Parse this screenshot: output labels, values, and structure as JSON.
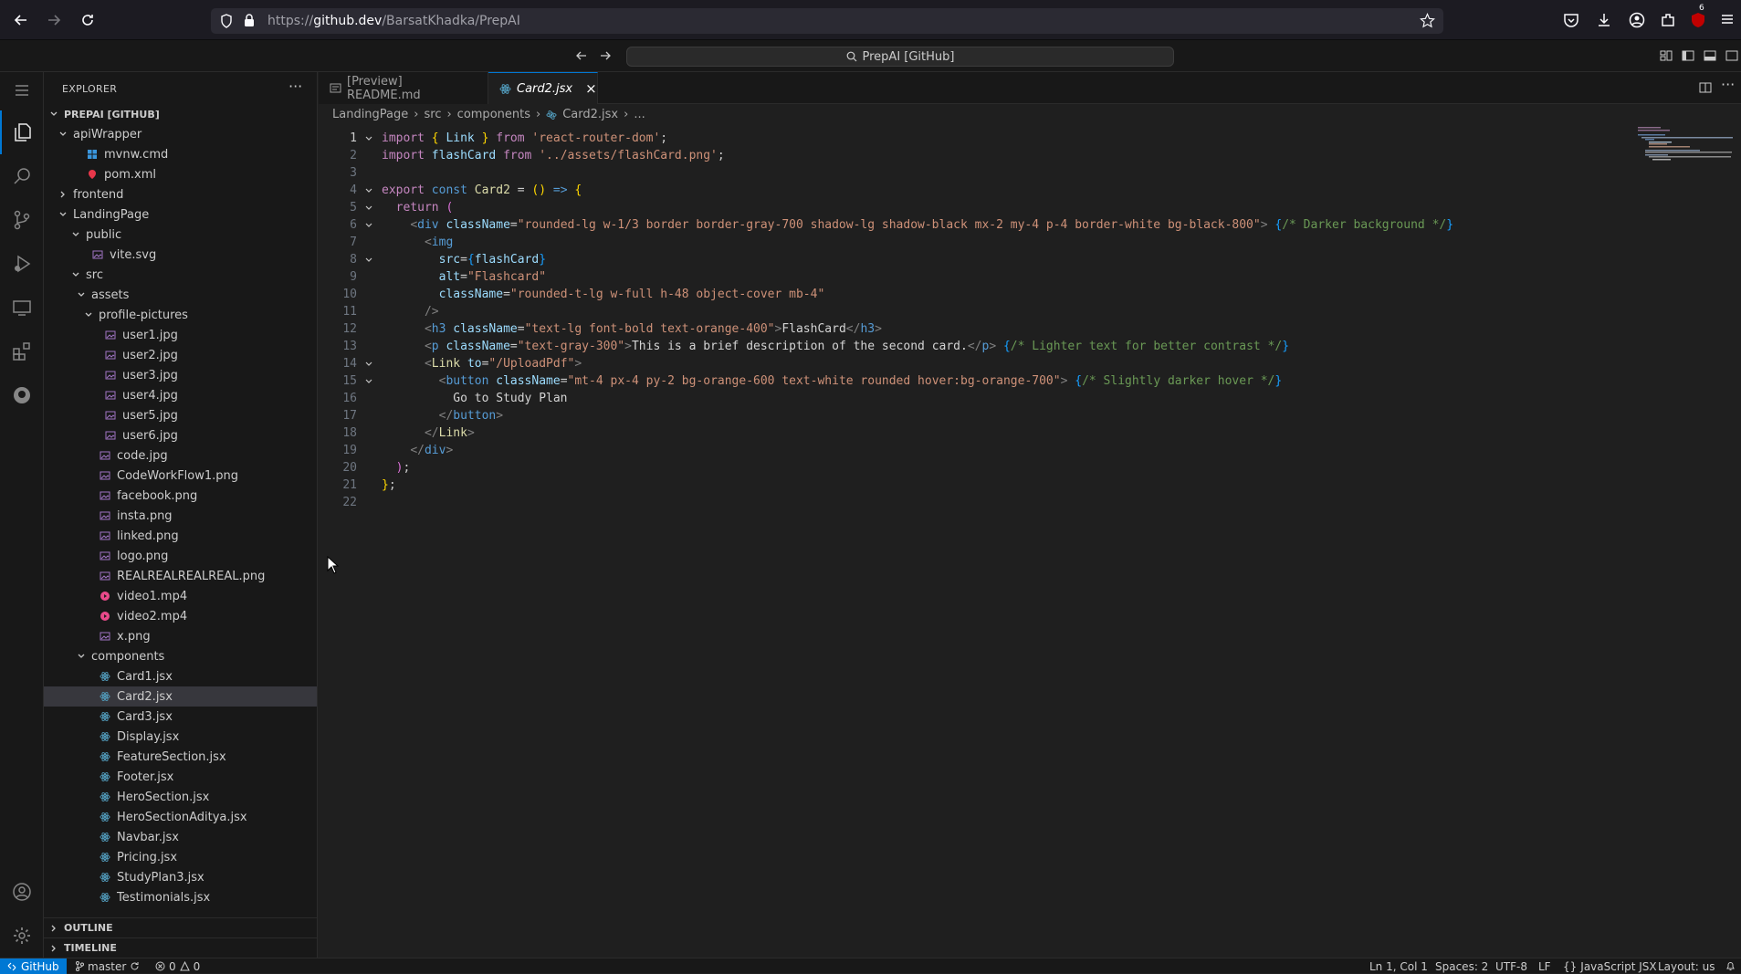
{
  "browser": {
    "url_prefix": "https://",
    "url_host": "github.dev",
    "url_path": "/BarsatKhadka/PrepAI",
    "badge_count": "6"
  },
  "vscode": {
    "command_center": "PrepAI [GitHub]"
  },
  "sidebar": {
    "title": "EXPLORER",
    "more": "···",
    "root": "PREPAI [GITHUB]",
    "tree": [
      {
        "label": "apiWrapper",
        "depth": 0,
        "kind": "folder-open"
      },
      {
        "label": "mvnw.cmd",
        "depth": 1,
        "kind": "cmd"
      },
      {
        "label": "pom.xml",
        "depth": 1,
        "kind": "xml"
      },
      {
        "label": "frontend",
        "depth": 0,
        "kind": "folder"
      },
      {
        "label": "LandingPage",
        "depth": 0,
        "kind": "folder-open"
      },
      {
        "label": "public",
        "depth": 1,
        "kind": "folder-open"
      },
      {
        "label": "vite.svg",
        "depth": 2,
        "kind": "svg"
      },
      {
        "label": "src",
        "depth": 1,
        "kind": "folder-open"
      },
      {
        "label": "assets",
        "depth": 2,
        "kind": "folder-open"
      },
      {
        "label": "profile-pictures",
        "depth": 3,
        "kind": "folder-open"
      },
      {
        "label": "user1.jpg",
        "depth": 4,
        "kind": "image"
      },
      {
        "label": "user2.jpg",
        "depth": 4,
        "kind": "image"
      },
      {
        "label": "user3.jpg",
        "depth": 4,
        "kind": "image"
      },
      {
        "label": "user4.jpg",
        "depth": 4,
        "kind": "image"
      },
      {
        "label": "user5.jpg",
        "depth": 4,
        "kind": "image"
      },
      {
        "label": "user6.jpg",
        "depth": 4,
        "kind": "image"
      },
      {
        "label": "code.jpg",
        "depth": 3,
        "kind": "image"
      },
      {
        "label": "CodeWorkFlow1.png",
        "depth": 3,
        "kind": "image"
      },
      {
        "label": "facebook.png",
        "depth": 3,
        "kind": "image"
      },
      {
        "label": "insta.png",
        "depth": 3,
        "kind": "image"
      },
      {
        "label": "linked.png",
        "depth": 3,
        "kind": "image"
      },
      {
        "label": "logo.png",
        "depth": 3,
        "kind": "image"
      },
      {
        "label": "REALREALREALREAL.png",
        "depth": 3,
        "kind": "image"
      },
      {
        "label": "video1.mp4",
        "depth": 3,
        "kind": "video"
      },
      {
        "label": "video2.mp4",
        "depth": 3,
        "kind": "video"
      },
      {
        "label": "x.png",
        "depth": 3,
        "kind": "image"
      },
      {
        "label": "components",
        "depth": 2,
        "kind": "folder-open"
      },
      {
        "label": "Card1.jsx",
        "depth": 3,
        "kind": "react"
      },
      {
        "label": "Card2.jsx",
        "depth": 3,
        "kind": "react",
        "selected": true
      },
      {
        "label": "Card3.jsx",
        "depth": 3,
        "kind": "react"
      },
      {
        "label": "Display.jsx",
        "depth": 3,
        "kind": "react"
      },
      {
        "label": "FeatureSection.jsx",
        "depth": 3,
        "kind": "react"
      },
      {
        "label": "Footer.jsx",
        "depth": 3,
        "kind": "react"
      },
      {
        "label": "HeroSection.jsx",
        "depth": 3,
        "kind": "react"
      },
      {
        "label": "HeroSectionAditya.jsx",
        "depth": 3,
        "kind": "react"
      },
      {
        "label": "Navbar.jsx",
        "depth": 3,
        "kind": "react"
      },
      {
        "label": "Pricing.jsx",
        "depth": 3,
        "kind": "react"
      },
      {
        "label": "StudyPlan3.jsx",
        "depth": 3,
        "kind": "react"
      },
      {
        "label": "Testimonials.jsx",
        "depth": 3,
        "kind": "react"
      }
    ],
    "outline": "OUTLINE",
    "timeline": "TIMELINE"
  },
  "tabs": [
    {
      "label": "[Preview] README.md"
    },
    {
      "label": "Card2.jsx",
      "close": "×"
    }
  ],
  "breadcrumbs": [
    "LandingPage",
    "src",
    "components",
    "Card2.jsx",
    "..."
  ],
  "code_lines": [
    {
      "n": "1",
      "fold": "v",
      "html": "<span class='k'>import</span> <span class='b'>{</span> <span class='v'>Link</span> <span class='b'>}</span> <span class='k'>from</span> <span class='s'>'react-router-dom'</span>;"
    },
    {
      "n": "2",
      "fold": "",
      "html": "<span class='k'>import</span> <span class='v'>flashCard</span> <span class='k'>from</span> <span class='s'>'../assets/flashCard.png'</span>;"
    },
    {
      "n": "3",
      "fold": "",
      "html": ""
    },
    {
      "n": "4",
      "fold": "v",
      "html": "<span class='k'>export</span> <span class='kw'>const</span> <span class='f'>Card2</span> = <span class='b'>()</span> <span class='kw'>=&gt;</span> <span class='b'>{</span>"
    },
    {
      "n": "5",
      "fold": "v",
      "html": "  <span class='k'>return</span> <span class='b2'>(</span>"
    },
    {
      "n": "6",
      "fold": "v",
      "html": "    <span class='p'>&lt;</span><span class='t'>div</span> <span class='a'>className</span>=<span class='s'>\"rounded-lg w-1/3 border border-gray-700 shadow-lg shadow-black mx-2 my-4 p-4 border-white bg-black-800\"</span><span class='p'>&gt;</span> <span class='b3'>{</span><span class='c'>/* Darker background */</span><span class='b3'>}</span>"
    },
    {
      "n": "7",
      "fold": "",
      "html": "      <span class='p'>&lt;</span><span class='t'>img</span>"
    },
    {
      "n": "8",
      "fold": "v",
      "html": "        <span class='a'>src</span>=<span class='b3'>{</span><span class='v'>flashCard</span><span class='b3'>}</span>"
    },
    {
      "n": "9",
      "fold": "",
      "html": "        <span class='a'>alt</span>=<span class='s'>\"Flashcard\"</span>"
    },
    {
      "n": "10",
      "fold": "",
      "html": "        <span class='a'>className</span>=<span class='s'>\"rounded-t-lg w-full h-48 object-cover mb-4\"</span>"
    },
    {
      "n": "11",
      "fold": "",
      "html": "      <span class='p'>/&gt;</span>"
    },
    {
      "n": "12",
      "fold": "",
      "html": "      <span class='p'>&lt;</span><span class='t'>h3</span> <span class='a'>className</span>=<span class='s'>\"text-lg font-bold text-orange-400\"</span><span class='p'>&gt;</span><span class='tx'>FlashCard</span><span class='p'>&lt;/</span><span class='t'>h3</span><span class='p'>&gt;</span>"
    },
    {
      "n": "13",
      "fold": "",
      "html": "      <span class='p'>&lt;</span><span class='t'>p</span> <span class='a'>className</span>=<span class='s'>\"text-gray-300\"</span><span class='p'>&gt;</span><span class='tx'>This is a brief description of the second card.</span><span class='p'>&lt;/</span><span class='t'>p</span><span class='p'>&gt;</span> <span class='b3'>{</span><span class='c'>/* Lighter text for better contrast */</span><span class='b3'>}</span>"
    },
    {
      "n": "14",
      "fold": "v",
      "html": "      <span class='p'>&lt;</span><span class='f'>Link</span> <span class='a'>to</span>=<span class='s'>\"/UploadPdf\"</span><span class='p'>&gt;</span>"
    },
    {
      "n": "15",
      "fold": "v",
      "html": "        <span class='p'>&lt;</span><span class='t'>button</span> <span class='a'>className</span>=<span class='s'>\"mt-4 px-4 py-2 bg-orange-600 text-white rounded hover:bg-orange-700\"</span><span class='p'>&gt;</span> <span class='b3'>{</span><span class='c'>/* Slightly darker hover */</span><span class='b3'>}</span>"
    },
    {
      "n": "16",
      "fold": "",
      "html": "          <span class='tx'>Go to Study Plan</span>"
    },
    {
      "n": "17",
      "fold": "",
      "html": "        <span class='p'>&lt;/</span><span class='t'>button</span><span class='p'>&gt;</span>"
    },
    {
      "n": "18",
      "fold": "",
      "html": "      <span class='p'>&lt;/</span><span class='f'>Link</span><span class='p'>&gt;</span>"
    },
    {
      "n": "19",
      "fold": "",
      "html": "    <span class='p'>&lt;/</span><span class='t'>div</span><span class='p'>&gt;</span>"
    },
    {
      "n": "20",
      "fold": "",
      "html": "  <span class='b2'>)</span>;"
    },
    {
      "n": "21",
      "fold": "",
      "html": "<span class='b'>}</span>;"
    },
    {
      "n": "22",
      "fold": "",
      "html": ""
    }
  ],
  "status": {
    "remote": "GitHub",
    "branch": "master",
    "errors": "0",
    "warnings": "0",
    "position": "Ln 1, Col 1",
    "spaces": "Spaces: 2",
    "encoding": "UTF-8",
    "eol": "LF",
    "language": "JavaScript JSX",
    "layout": "Layout: us"
  },
  "colors": {
    "accent": "#0078d4",
    "react_icon": "#519aba",
    "image_icon": "#a074c4",
    "video_icon": "#e84a8a"
  }
}
